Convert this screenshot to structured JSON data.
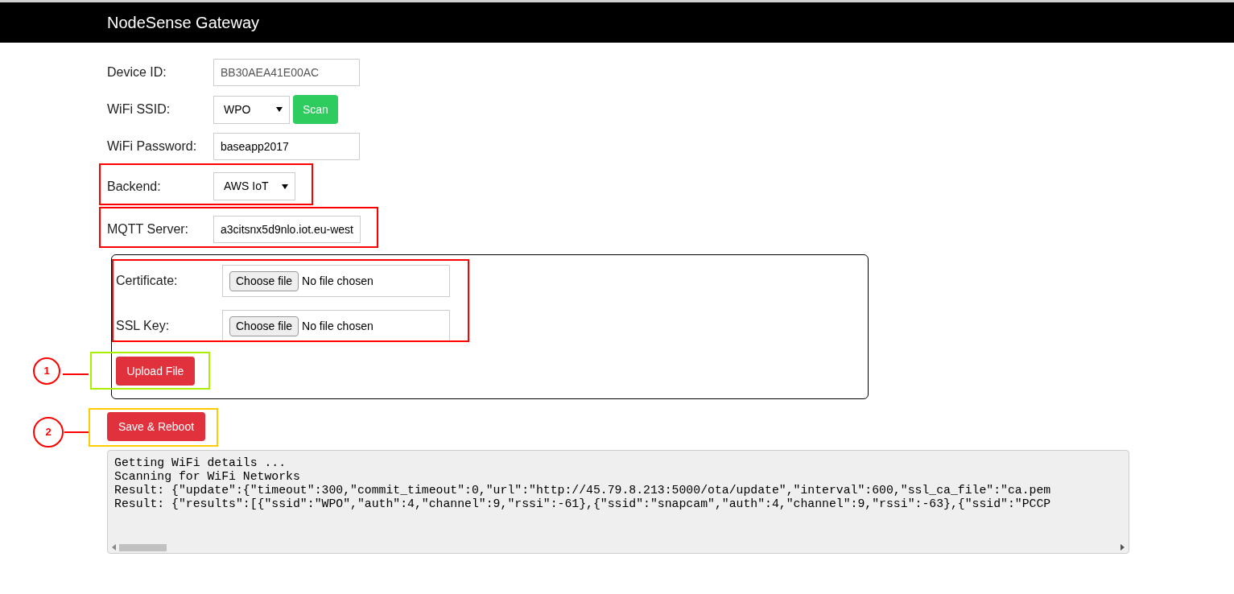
{
  "header": {
    "title": "NodeSense Gateway"
  },
  "fields": [
    {
      "kind": "readonly",
      "label": "Device ID:",
      "value": "BB30AEA41E00AC"
    },
    {
      "kind": "select",
      "label": "WiFi SSID:",
      "value": "WPO",
      "button": "Scan"
    },
    {
      "kind": "input",
      "label": "WiFi Password:",
      "value": "baseapp2017"
    },
    {
      "kind": "select",
      "label": "Backend:",
      "value": "AWS IoT",
      "highlight": {
        "color": "#ff0000"
      }
    },
    {
      "kind": "input",
      "label": "MQTT Server:",
      "value": "a3citsnx5d9nlo.iot.eu-west",
      "highlight": {
        "color": "#ff0000"
      }
    }
  ],
  "upload_panel": {
    "highlight": {
      "color": "#ff0000"
    },
    "files": [
      {
        "label": "Certificate:",
        "button": "Choose file",
        "status": "No file chosen"
      },
      {
        "label": "SSL Key:",
        "button": "Choose file",
        "status": "No file chosen"
      }
    ],
    "upload": {
      "label": "Upload File",
      "highlight": {
        "color": "#aaee00"
      },
      "marker": "1"
    }
  },
  "save": {
    "label": "Save & Reboot",
    "highlight": {
      "color": "#ffcc00"
    },
    "marker": "2"
  },
  "log": {
    "lines": [
      "Getting WiFi details ...",
      "Scanning for WiFi Networks",
      "Result: {\"update\":{\"timeout\":300,\"commit_timeout\":0,\"url\":\"http://45.79.8.213:5000/ota/update\",\"interval\":600,\"ssl_ca_file\":\"ca.pem",
      "Result: {\"results\":[{\"ssid\":\"WPO\",\"auth\":4,\"channel\":9,\"rssi\":-61},{\"ssid\":\"snapcam\",\"auth\":4,\"channel\":9,\"rssi\":-63},{\"ssid\":\"PCCP"
    ]
  }
}
